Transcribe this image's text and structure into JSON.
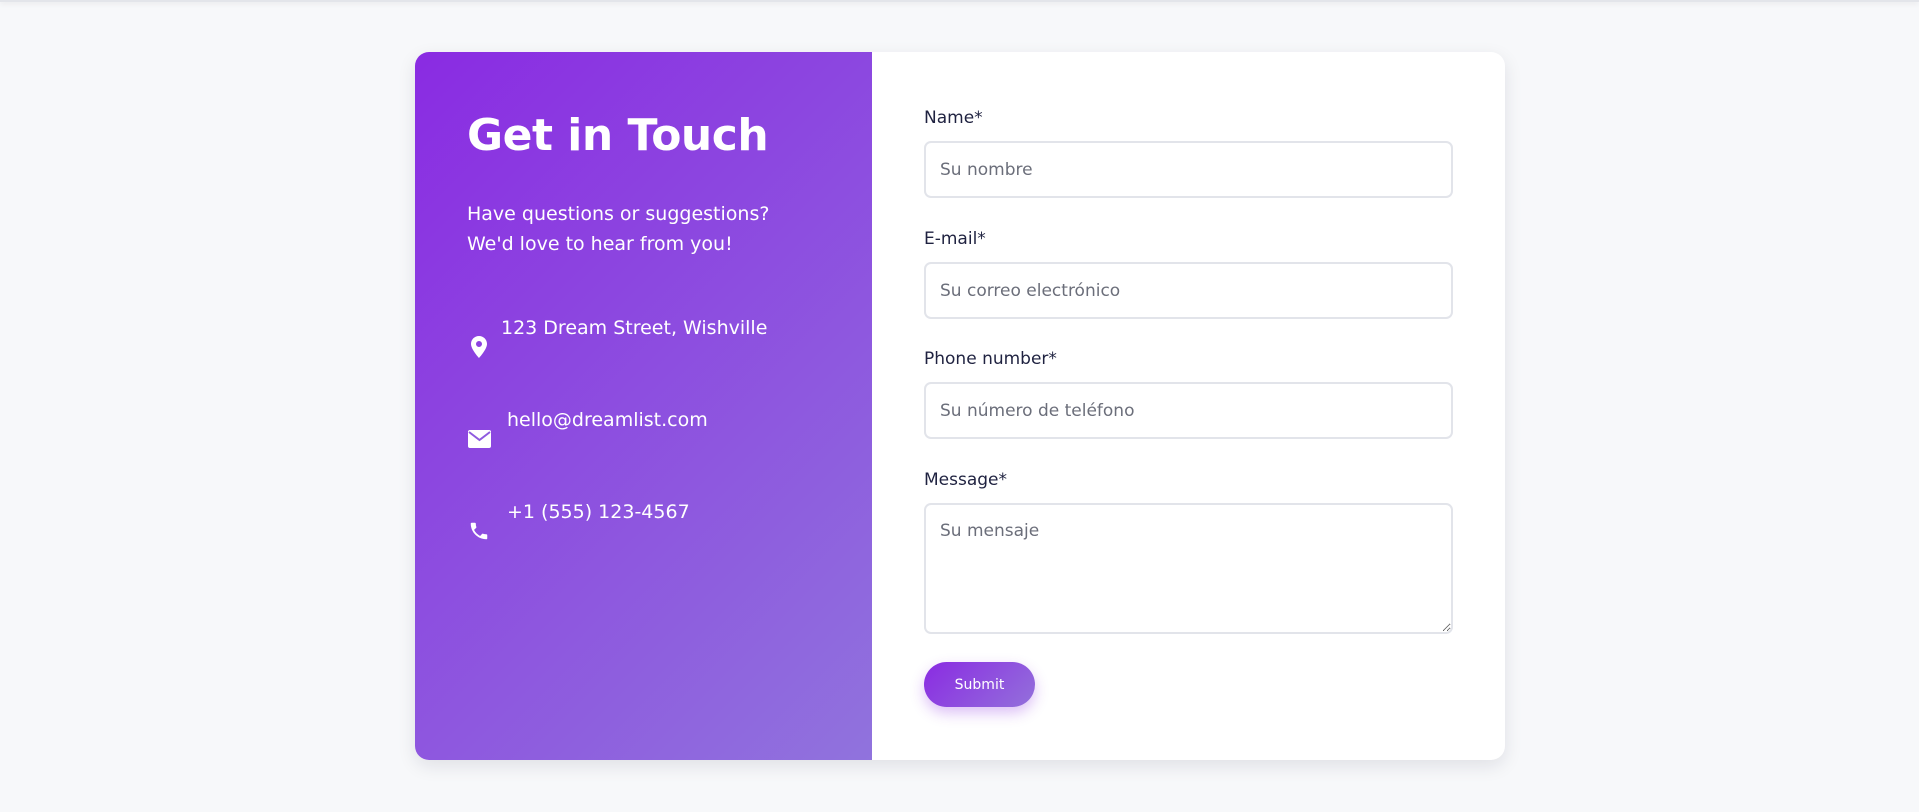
{
  "contact_info": {
    "title": "Get in Touch",
    "subtitle": "Have questions or suggestions? We'd love to hear from you!",
    "items": [
      {
        "icon": "map-pin-icon",
        "text": "123 Dream Street, Wishville"
      },
      {
        "icon": "envelope-icon",
        "text": "hello@dreamlist.com"
      },
      {
        "icon": "phone-icon",
        "text": "+1 (555) 123-4567"
      }
    ],
    "gradient": {
      "start": "#8a2be2",
      "end": "#9370db"
    }
  },
  "form": {
    "fields": {
      "name": {
        "label": "Name*",
        "placeholder": "Su nombre",
        "value": ""
      },
      "email": {
        "label": "E-mail*",
        "placeholder": "Su correo electrónico",
        "value": ""
      },
      "phone": {
        "label": "Phone number*",
        "placeholder": "Su número de teléfono",
        "value": ""
      },
      "message": {
        "label": "Message*",
        "placeholder": "Su mensaje",
        "value": ""
      }
    },
    "submit_label": "Submit"
  },
  "colors": {
    "page_background": "#f7f8fa",
    "label_text": "#1f2240",
    "input_border": "#e2e4ea"
  }
}
